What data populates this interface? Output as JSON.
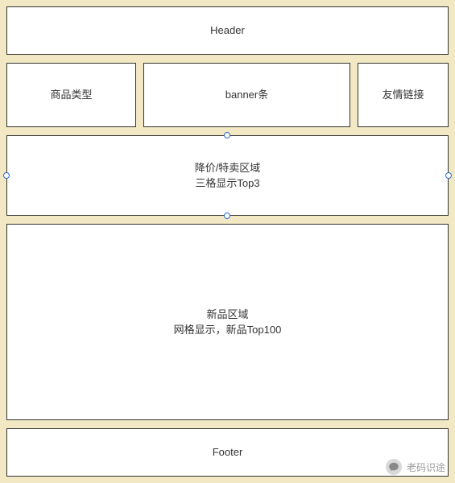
{
  "layout": {
    "header": {
      "label": "Header"
    },
    "columns": {
      "left": {
        "label": "商品类型"
      },
      "middle": {
        "label": "banner条"
      },
      "right": {
        "label": "友情链接"
      }
    },
    "discount": {
      "line1": "降价/特卖区域",
      "line2": "三格显示Top3"
    },
    "new_products": {
      "line1": "新品区域",
      "line2": "网格显示，新品Top100"
    },
    "footer": {
      "label": "Footer"
    }
  },
  "watermark": {
    "text": "老码识途"
  }
}
